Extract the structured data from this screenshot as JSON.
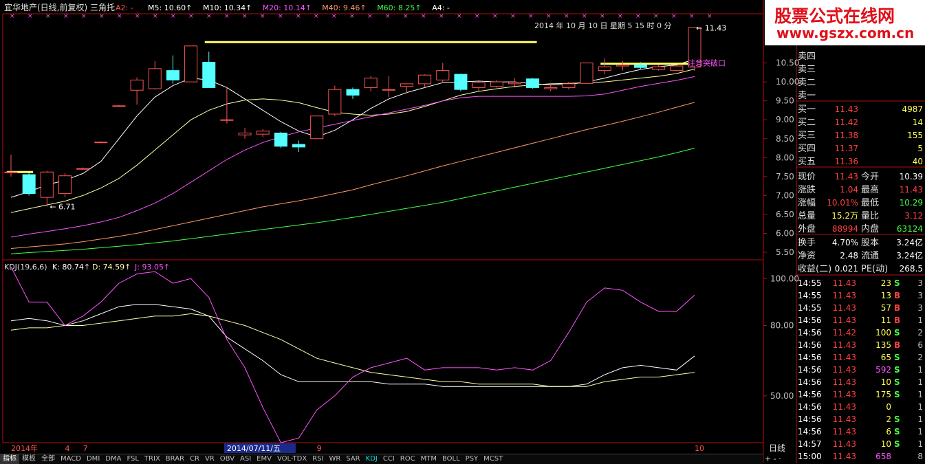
{
  "header": {
    "title": "宜华地产(日线,前复权) 三角托",
    "indicators": [
      {
        "label": "A2: -",
        "color": "#ff5555"
      },
      {
        "label": "M5: 10.60↑",
        "color": "#ffffff"
      },
      {
        "label": "M10: 10.34↑",
        "color": "#ffffff"
      },
      {
        "label": "M20: 10.14↑",
        "color": "#ff55ff"
      },
      {
        "label": "M40: 9.46↑",
        "color": "#ff9966"
      },
      {
        "label": "M60: 8.25↑",
        "color": "#44ff44"
      },
      {
        "label": "A4: -",
        "color": "#ffffff"
      }
    ],
    "date_text": "2014 年 10 月 10 日 星期 5  15 时 0 分"
  },
  "annotations": {
    "low_marker": "← 6.71",
    "high_marker": "← 11.43",
    "breakout": "注意突破口"
  },
  "kdj_header": {
    "name": "KDJ(19,6,6)",
    "k": "K: 80.74↑",
    "d": "D: 74.59↑",
    "j": "J: 93.05↑"
  },
  "xaxis_labels": [
    {
      "text": "2014年",
      "pos": 0
    },
    {
      "text": "4",
      "pos": 3
    },
    {
      "text": "7",
      "pos": 4
    },
    {
      "text": "2014/07/11/五",
      "pos": 12,
      "highlight": true
    },
    {
      "text": "9",
      "pos": 17
    },
    {
      "text": "10",
      "pos": 38
    }
  ],
  "period_label": "日线",
  "toolbar": [
    "指标",
    "模板",
    "全部",
    "MACD",
    "DMI",
    "DMA",
    "FSL",
    "TRIX",
    "BRAR",
    "CR",
    "VR",
    "OBV",
    "ASI",
    "EMV",
    "VOL-TDX",
    "RSI",
    "WR",
    "SAR",
    "KDJ",
    "CCI",
    "ROC",
    "MTM",
    "BOLL",
    "PSY",
    "MCST"
  ],
  "toolbar_active": "KDJ",
  "logo": {
    "line1": "股票公式在线网",
    "line2": "www.gszx.com.cn"
  },
  "order_book": {
    "sell": [
      {
        "label": "卖四"
      },
      {
        "label": "卖三"
      },
      {
        "label": "卖二"
      },
      {
        "label": "卖一"
      }
    ],
    "buy": [
      {
        "label": "买一",
        "price": "11.43",
        "vol": "4987"
      },
      {
        "label": "买二",
        "price": "11.42",
        "vol": "14"
      },
      {
        "label": "买三",
        "price": "11.38",
        "vol": "155"
      },
      {
        "label": "买四",
        "price": "11.37",
        "vol": "5"
      },
      {
        "label": "买五",
        "price": "11.36",
        "vol": "40"
      }
    ]
  },
  "quote": [
    {
      "l1": "现价",
      "v1": "11.43",
      "c1": "#ff4040",
      "l2": "今开",
      "v2": "10.39",
      "c2": "#ffffff"
    },
    {
      "l1": "涨跌",
      "v1": "1.04",
      "c1": "#ff4040",
      "l2": "最高",
      "v2": "11.43",
      "c2": "#ff4040"
    },
    {
      "l1": "涨幅",
      "v1": "10.01%",
      "c1": "#ff4040",
      "l2": "最低",
      "v2": "10.29",
      "c2": "#44ff44"
    },
    {
      "l1": "总量",
      "v1": "15.2万",
      "c1": "#ffff55",
      "l2": "量比",
      "v2": "3.12",
      "c2": "#ff4040"
    },
    {
      "l1": "外盘",
      "v1": "88994",
      "c1": "#ff4040",
      "l2": "内盘",
      "v2": "63124",
      "c2": "#44ff44"
    }
  ],
  "fundamentals": [
    {
      "l1": "换手",
      "v1": "4.70%",
      "l2": "股本",
      "v2": "3.24亿"
    },
    {
      "l1": "净资",
      "v1": "2.48",
      "l2": "流通",
      "v2": "3.24亿"
    },
    {
      "l1": "收益(二)",
      "v1": "0.021",
      "l2": "PE(动)",
      "v2": "268.5"
    }
  ],
  "ticks": [
    {
      "time": "14:55",
      "price": "11.43",
      "vol": "23",
      "side": "S",
      "n": "3"
    },
    {
      "time": "14:55",
      "price": "11.43",
      "vol": "13",
      "side": "B",
      "n": "3"
    },
    {
      "time": "14:55",
      "price": "11.43",
      "vol": "57",
      "side": "B",
      "n": "3"
    },
    {
      "time": "14:56",
      "price": "11.43",
      "vol": "11",
      "side": "B",
      "n": "1"
    },
    {
      "time": "14:56",
      "price": "11.42",
      "vol": "100",
      "side": "S",
      "n": "2"
    },
    {
      "time": "14:56",
      "price": "11.43",
      "vol": "135",
      "side": "B",
      "n": "6"
    },
    {
      "time": "14:56",
      "price": "11.43",
      "vol": "65",
      "side": "S",
      "n": "2"
    },
    {
      "time": "14:56",
      "price": "11.43",
      "vol": "592",
      "side": "S",
      "n": "1"
    },
    {
      "time": "14:56",
      "price": "11.43",
      "vol": "10",
      "side": "S",
      "n": "1"
    },
    {
      "time": "14:56",
      "price": "11.43",
      "vol": "175",
      "side": "S",
      "n": "1"
    },
    {
      "time": "14:56",
      "price": "11.43",
      "vol": "0",
      "side": "",
      "n": "1"
    },
    {
      "time": "14:56",
      "price": "11.43",
      "vol": "2",
      "side": "S",
      "n": "1"
    },
    {
      "time": "14:56",
      "price": "11.43",
      "vol": "6",
      "side": "S",
      "n": "1"
    },
    {
      "time": "14:57",
      "price": "11.43",
      "vol": "10",
      "side": "S",
      "n": "1"
    },
    {
      "time": "15:00",
      "price": "11.43",
      "vol": "658",
      "side": "",
      "n": "8"
    }
  ],
  "chart_data": [
    {
      "type": "candlestick",
      "title": "宜华地产(日线,前复权) 三角托",
      "ylim": [
        5.3,
        11.8
      ],
      "yticks": [
        "5.50",
        "6.00",
        "6.50",
        "7.00",
        "7.50",
        "8.00",
        "8.50",
        "9.00",
        "9.50",
        "10.00",
        "10.50"
      ],
      "candles": [
        {
          "o": 7.62,
          "h": 8.08,
          "l": 7.5,
          "c": 7.62
        },
        {
          "o": 7.55,
          "h": 7.6,
          "l": 7.0,
          "c": 7.05
        },
        {
          "o": 6.95,
          "h": 7.65,
          "l": 6.71,
          "c": 7.62
        },
        {
          "o": 7.05,
          "h": 7.6,
          "l": 6.95,
          "c": 7.52
        },
        {
          "o": 7.71,
          "h": 7.74,
          "l": 7.68,
          "c": 7.71
        },
        {
          "o": 8.41,
          "h": 8.43,
          "l": 8.39,
          "c": 8.41
        },
        {
          "o": 9.37,
          "h": 9.39,
          "l": 9.35,
          "c": 9.37
        },
        {
          "o": 9.78,
          "h": 10.12,
          "l": 9.4,
          "c": 10.05
        },
        {
          "o": 9.82,
          "h": 10.55,
          "l": 9.8,
          "c": 10.35
        },
        {
          "o": 10.3,
          "h": 10.7,
          "l": 9.95,
          "c": 10.05
        },
        {
          "o": 10.0,
          "h": 10.95,
          "l": 10.0,
          "c": 10.95
        },
        {
          "o": 10.52,
          "h": 10.8,
          "l": 9.85,
          "c": 9.85
        },
        {
          "o": 9.0,
          "h": 9.85,
          "l": 8.9,
          "c": 9.0
        },
        {
          "o": 8.6,
          "h": 8.78,
          "l": 8.5,
          "c": 8.65
        },
        {
          "o": 8.62,
          "h": 8.75,
          "l": 8.55,
          "c": 8.7
        },
        {
          "o": 8.65,
          "h": 8.68,
          "l": 8.25,
          "c": 8.3
        },
        {
          "o": 8.35,
          "h": 8.45,
          "l": 8.15,
          "c": 8.28
        },
        {
          "o": 8.5,
          "h": 9.1,
          "l": 8.5,
          "c": 9.1
        },
        {
          "o": 9.15,
          "h": 9.9,
          "l": 9.1,
          "c": 9.8
        },
        {
          "o": 9.8,
          "h": 9.85,
          "l": 9.55,
          "c": 9.65
        },
        {
          "o": 9.85,
          "h": 10.15,
          "l": 9.75,
          "c": 10.1
        },
        {
          "o": 9.78,
          "h": 10.15,
          "l": 9.6,
          "c": 9.8
        },
        {
          "o": 9.88,
          "h": 9.95,
          "l": 9.7,
          "c": 9.95
        },
        {
          "o": 9.95,
          "h": 10.2,
          "l": 9.85,
          "c": 10.18
        },
        {
          "o": 10.05,
          "h": 10.5,
          "l": 10.0,
          "c": 10.3
        },
        {
          "o": 10.2,
          "h": 10.22,
          "l": 9.75,
          "c": 9.8
        },
        {
          "o": 9.85,
          "h": 10.05,
          "l": 9.75,
          "c": 9.98
        },
        {
          "o": 9.88,
          "h": 10.05,
          "l": 9.85,
          "c": 10.0
        },
        {
          "o": 9.95,
          "h": 10.1,
          "l": 9.85,
          "c": 9.99
        },
        {
          "o": 10.08,
          "h": 10.1,
          "l": 9.82,
          "c": 9.85
        },
        {
          "o": 9.82,
          "h": 9.92,
          "l": 9.75,
          "c": 9.85
        },
        {
          "o": 9.85,
          "h": 10.0,
          "l": 9.8,
          "c": 9.95
        },
        {
          "o": 9.96,
          "h": 10.5,
          "l": 9.95,
          "c": 10.5
        },
        {
          "o": 10.3,
          "h": 10.62,
          "l": 10.2,
          "c": 10.4
        },
        {
          "o": 10.42,
          "h": 10.55,
          "l": 10.3,
          "c": 10.45
        },
        {
          "o": 10.45,
          "h": 10.52,
          "l": 10.35,
          "c": 10.38
        },
        {
          "o": 10.33,
          "h": 10.45,
          "l": 10.3,
          "c": 10.4
        },
        {
          "o": 10.3,
          "h": 10.45,
          "l": 10.28,
          "c": 10.42
        },
        {
          "o": 10.39,
          "h": 11.43,
          "l": 10.29,
          "c": 11.43
        }
      ],
      "ma": [
        {
          "name": "M5",
          "color": "#ffffff",
          "values": [
            6.95,
            7.1,
            7.28,
            7.4,
            7.58,
            7.9,
            8.5,
            9.1,
            9.6,
            9.9,
            10.1,
            10.05,
            9.85,
            9.55,
            9.25,
            8.95,
            8.7,
            8.55,
            8.72,
            9.0,
            9.3,
            9.55,
            9.72,
            9.85,
            9.98,
            10.0,
            10.02,
            10.0,
            10.0,
            9.95,
            9.92,
            9.93,
            10.0,
            10.1,
            10.22,
            10.33,
            10.4,
            10.45,
            10.6
          ]
        },
        {
          "name": "M10",
          "color": "#ffffaa",
          "values": [
            6.55,
            6.65,
            6.75,
            6.85,
            7.0,
            7.2,
            7.45,
            7.8,
            8.2,
            8.6,
            9.0,
            9.25,
            9.42,
            9.52,
            9.55,
            9.52,
            9.45,
            9.32,
            9.2,
            9.15,
            9.12,
            9.15,
            9.22,
            9.35,
            9.5,
            9.65,
            9.75,
            9.82,
            9.88,
            9.92,
            9.95,
            9.96,
            9.98,
            10.0,
            10.05,
            10.1,
            10.15,
            10.22,
            10.34
          ]
        },
        {
          "name": "M20",
          "color": "#ff55ff",
          "values": [
            5.9,
            5.98,
            6.05,
            6.12,
            6.2,
            6.3,
            6.42,
            6.6,
            6.8,
            7.05,
            7.35,
            7.65,
            7.95,
            8.2,
            8.4,
            8.55,
            8.68,
            8.78,
            8.88,
            8.98,
            9.08,
            9.18,
            9.28,
            9.38,
            9.5,
            9.58,
            9.62,
            9.62,
            9.62,
            9.62,
            9.62,
            9.62,
            9.63,
            9.68,
            9.78,
            9.88,
            9.96,
            10.04,
            10.14
          ]
        },
        {
          "name": "M40",
          "color": "#ff9966",
          "values": [
            5.6,
            5.64,
            5.68,
            5.72,
            5.78,
            5.85,
            5.92,
            6.0,
            6.1,
            6.2,
            6.3,
            6.4,
            6.5,
            6.6,
            6.7,
            6.78,
            6.86,
            6.95,
            7.05,
            7.15,
            7.28,
            7.4,
            7.52,
            7.65,
            7.78,
            7.9,
            8.02,
            8.14,
            8.26,
            8.38,
            8.5,
            8.62,
            8.74,
            8.85,
            8.96,
            9.08,
            9.2,
            9.33,
            9.46
          ]
        },
        {
          "name": "M60",
          "color": "#44ff44",
          "values": [
            5.46,
            5.49,
            5.52,
            5.55,
            5.58,
            5.62,
            5.66,
            5.7,
            5.75,
            5.8,
            5.86,
            5.92,
            5.98,
            6.04,
            6.1,
            6.16,
            6.22,
            6.28,
            6.35,
            6.42,
            6.5,
            6.58,
            6.66,
            6.74,
            6.82,
            6.92,
            7.02,
            7.12,
            7.22,
            7.32,
            7.42,
            7.52,
            7.62,
            7.72,
            7.82,
            7.92,
            8.02,
            8.13,
            8.25
          ]
        }
      ],
      "resistance_lines": [
        {
          "from": 11,
          "to": 29,
          "y": 11.05,
          "color": "#ffff66"
        },
        {
          "from": 33,
          "to": 38,
          "y": 10.48,
          "color": "#ffff66"
        },
        {
          "from": 0,
          "to": 1,
          "y": 7.62,
          "color": "#ffff66"
        }
      ]
    },
    {
      "type": "line",
      "title": "KDJ(19,6,6)",
      "ylim": [
        30,
        108
      ],
      "yticks": [
        "50.00",
        "80.00",
        "100.00"
      ],
      "series": [
        {
          "name": "K",
          "color": "#ffffff",
          "values": [
            82,
            83,
            82,
            80,
            82,
            85,
            88,
            89,
            89,
            88,
            87,
            84,
            75,
            70,
            65,
            59,
            56,
            56,
            56,
            56,
            56,
            55,
            55,
            55,
            54,
            54,
            54,
            54,
            54,
            54,
            54,
            54,
            55,
            59,
            62,
            63,
            62,
            61,
            67
          ]
        },
        {
          "name": "D",
          "color": "#ffffaa",
          "values": [
            78,
            79,
            79,
            80,
            80,
            81,
            82,
            83,
            84,
            84,
            85,
            84,
            82,
            80,
            77,
            74,
            70,
            66,
            64,
            62,
            60,
            59,
            58,
            57,
            56,
            56,
            55,
            55,
            55,
            55,
            54,
            54,
            54,
            56,
            57,
            58,
            58,
            59,
            60
          ]
        },
        {
          "name": "J",
          "color": "#ff55ff",
          "values": [
            105,
            90,
            90,
            80,
            84,
            90,
            98,
            102,
            103,
            98,
            100,
            92,
            74,
            62,
            45,
            30,
            32,
            44,
            50,
            58,
            62,
            64,
            66,
            61,
            62,
            62,
            62,
            61,
            62,
            61,
            65,
            77,
            90,
            96,
            95,
            90,
            86,
            86,
            93
          ]
        }
      ]
    }
  ]
}
